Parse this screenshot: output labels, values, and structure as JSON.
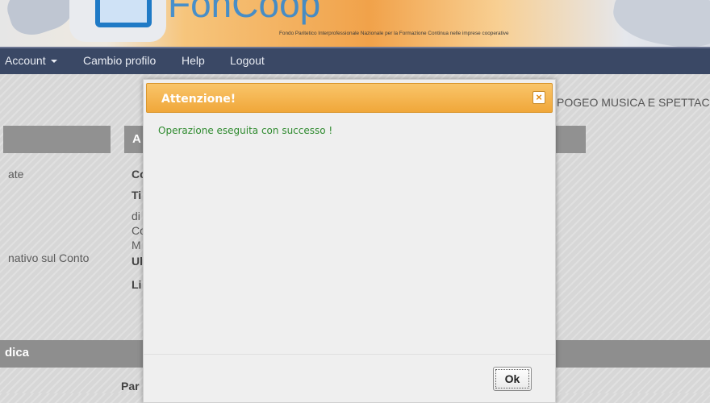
{
  "banner": {
    "logo_text": "FonCoop",
    "tagline": "Fondo Paritetico Interprofessionale Nazionale per la Formazione Continua nelle imprese cooperative"
  },
  "nav": {
    "account_label": "Account",
    "cambio_profilo_label": "Cambio profilo",
    "help_label": "Help",
    "logout_label": "Logout"
  },
  "background": {
    "company_name_partial": "POGEO MUSICA E SPETTAC",
    "section_header_left": "",
    "section_header_mid": "A",
    "left_lines": [
      "ate",
      "nativo sul Conto"
    ],
    "mid_lines": [
      "Co",
      "Ti",
      "di",
      "Co",
      "M",
      "Ul",
      "Li"
    ],
    "bottom_section_label": "dica",
    "bottom_text": "Par"
  },
  "modal": {
    "title": "Attenzione!",
    "close_symbol": "×",
    "message": "Operazione eseguita con successo !",
    "ok_label": "Ok"
  },
  "colors": {
    "nav_bg": "#3a4865",
    "modal_header": "#f0a73a",
    "success_text": "#2e8a2e"
  }
}
